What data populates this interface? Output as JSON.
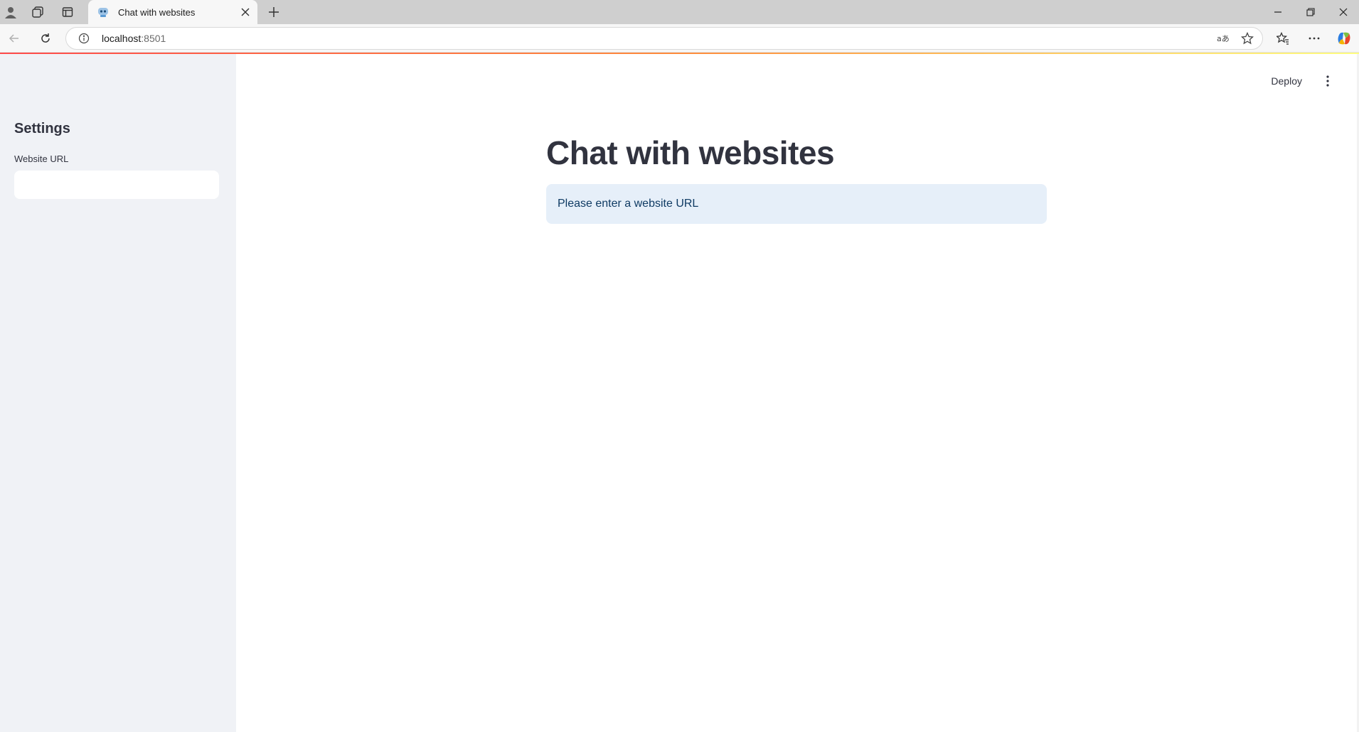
{
  "browser": {
    "tab_title": "Chat with websites",
    "url_host": "localhost",
    "url_port": ":8501"
  },
  "header": {
    "deploy_label": "Deploy"
  },
  "sidebar": {
    "title": "Settings",
    "website_url_label": "Website URL",
    "website_url_value": ""
  },
  "main": {
    "title": "Chat with websites",
    "info_message": "Please enter a website URL"
  },
  "colors": {
    "sidebar_bg": "#f0f2f6",
    "info_bg": "#e6eff9",
    "info_text": "#0e3a63",
    "title_text": "#31333f",
    "accent": "#ff4b4b"
  },
  "icons": [
    "profile-icon",
    "workspaces-icon",
    "vertical-tabs-icon",
    "tab-favicon",
    "close-icon",
    "new-tab-icon",
    "minimize-icon",
    "restore-icon",
    "window-close-icon",
    "back-icon",
    "refresh-icon",
    "info-icon",
    "read-aloud-icon",
    "star-icon",
    "favorites-icon",
    "more-icon",
    "copilot-icon",
    "kebab-menu-icon"
  ]
}
